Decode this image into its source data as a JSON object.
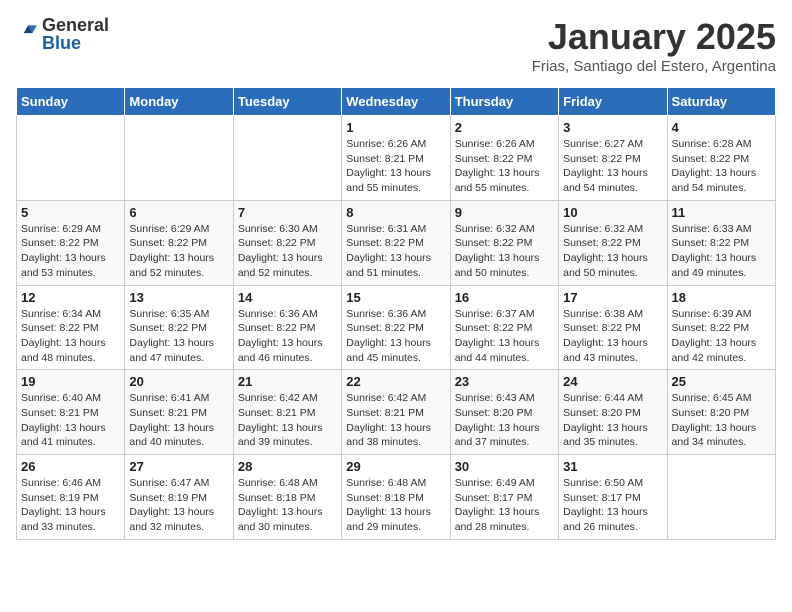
{
  "header": {
    "logo_general": "General",
    "logo_blue": "Blue",
    "title": "January 2025",
    "subtitle": "Frias, Santiago del Estero, Argentina"
  },
  "calendar": {
    "days_of_week": [
      "Sunday",
      "Monday",
      "Tuesday",
      "Wednesday",
      "Thursday",
      "Friday",
      "Saturday"
    ],
    "weeks": [
      [
        {
          "day": "",
          "info": ""
        },
        {
          "day": "",
          "info": ""
        },
        {
          "day": "",
          "info": ""
        },
        {
          "day": "1",
          "info": "Sunrise: 6:26 AM\nSunset: 8:21 PM\nDaylight: 13 hours\nand 55 minutes."
        },
        {
          "day": "2",
          "info": "Sunrise: 6:26 AM\nSunset: 8:22 PM\nDaylight: 13 hours\nand 55 minutes."
        },
        {
          "day": "3",
          "info": "Sunrise: 6:27 AM\nSunset: 8:22 PM\nDaylight: 13 hours\nand 54 minutes."
        },
        {
          "day": "4",
          "info": "Sunrise: 6:28 AM\nSunset: 8:22 PM\nDaylight: 13 hours\nand 54 minutes."
        }
      ],
      [
        {
          "day": "5",
          "info": "Sunrise: 6:29 AM\nSunset: 8:22 PM\nDaylight: 13 hours\nand 53 minutes."
        },
        {
          "day": "6",
          "info": "Sunrise: 6:29 AM\nSunset: 8:22 PM\nDaylight: 13 hours\nand 52 minutes."
        },
        {
          "day": "7",
          "info": "Sunrise: 6:30 AM\nSunset: 8:22 PM\nDaylight: 13 hours\nand 52 minutes."
        },
        {
          "day": "8",
          "info": "Sunrise: 6:31 AM\nSunset: 8:22 PM\nDaylight: 13 hours\nand 51 minutes."
        },
        {
          "day": "9",
          "info": "Sunrise: 6:32 AM\nSunset: 8:22 PM\nDaylight: 13 hours\nand 50 minutes."
        },
        {
          "day": "10",
          "info": "Sunrise: 6:32 AM\nSunset: 8:22 PM\nDaylight: 13 hours\nand 50 minutes."
        },
        {
          "day": "11",
          "info": "Sunrise: 6:33 AM\nSunset: 8:22 PM\nDaylight: 13 hours\nand 49 minutes."
        }
      ],
      [
        {
          "day": "12",
          "info": "Sunrise: 6:34 AM\nSunset: 8:22 PM\nDaylight: 13 hours\nand 48 minutes."
        },
        {
          "day": "13",
          "info": "Sunrise: 6:35 AM\nSunset: 8:22 PM\nDaylight: 13 hours\nand 47 minutes."
        },
        {
          "day": "14",
          "info": "Sunrise: 6:36 AM\nSunset: 8:22 PM\nDaylight: 13 hours\nand 46 minutes."
        },
        {
          "day": "15",
          "info": "Sunrise: 6:36 AM\nSunset: 8:22 PM\nDaylight: 13 hours\nand 45 minutes."
        },
        {
          "day": "16",
          "info": "Sunrise: 6:37 AM\nSunset: 8:22 PM\nDaylight: 13 hours\nand 44 minutes."
        },
        {
          "day": "17",
          "info": "Sunrise: 6:38 AM\nSunset: 8:22 PM\nDaylight: 13 hours\nand 43 minutes."
        },
        {
          "day": "18",
          "info": "Sunrise: 6:39 AM\nSunset: 8:22 PM\nDaylight: 13 hours\nand 42 minutes."
        }
      ],
      [
        {
          "day": "19",
          "info": "Sunrise: 6:40 AM\nSunset: 8:21 PM\nDaylight: 13 hours\nand 41 minutes."
        },
        {
          "day": "20",
          "info": "Sunrise: 6:41 AM\nSunset: 8:21 PM\nDaylight: 13 hours\nand 40 minutes."
        },
        {
          "day": "21",
          "info": "Sunrise: 6:42 AM\nSunset: 8:21 PM\nDaylight: 13 hours\nand 39 minutes."
        },
        {
          "day": "22",
          "info": "Sunrise: 6:42 AM\nSunset: 8:21 PM\nDaylight: 13 hours\nand 38 minutes."
        },
        {
          "day": "23",
          "info": "Sunrise: 6:43 AM\nSunset: 8:20 PM\nDaylight: 13 hours\nand 37 minutes."
        },
        {
          "day": "24",
          "info": "Sunrise: 6:44 AM\nSunset: 8:20 PM\nDaylight: 13 hours\nand 35 minutes."
        },
        {
          "day": "25",
          "info": "Sunrise: 6:45 AM\nSunset: 8:20 PM\nDaylight: 13 hours\nand 34 minutes."
        }
      ],
      [
        {
          "day": "26",
          "info": "Sunrise: 6:46 AM\nSunset: 8:19 PM\nDaylight: 13 hours\nand 33 minutes."
        },
        {
          "day": "27",
          "info": "Sunrise: 6:47 AM\nSunset: 8:19 PM\nDaylight: 13 hours\nand 32 minutes."
        },
        {
          "day": "28",
          "info": "Sunrise: 6:48 AM\nSunset: 8:18 PM\nDaylight: 13 hours\nand 30 minutes."
        },
        {
          "day": "29",
          "info": "Sunrise: 6:48 AM\nSunset: 8:18 PM\nDaylight: 13 hours\nand 29 minutes."
        },
        {
          "day": "30",
          "info": "Sunrise: 6:49 AM\nSunset: 8:17 PM\nDaylight: 13 hours\nand 28 minutes."
        },
        {
          "day": "31",
          "info": "Sunrise: 6:50 AM\nSunset: 8:17 PM\nDaylight: 13 hours\nand 26 minutes."
        },
        {
          "day": "",
          "info": ""
        }
      ]
    ]
  }
}
